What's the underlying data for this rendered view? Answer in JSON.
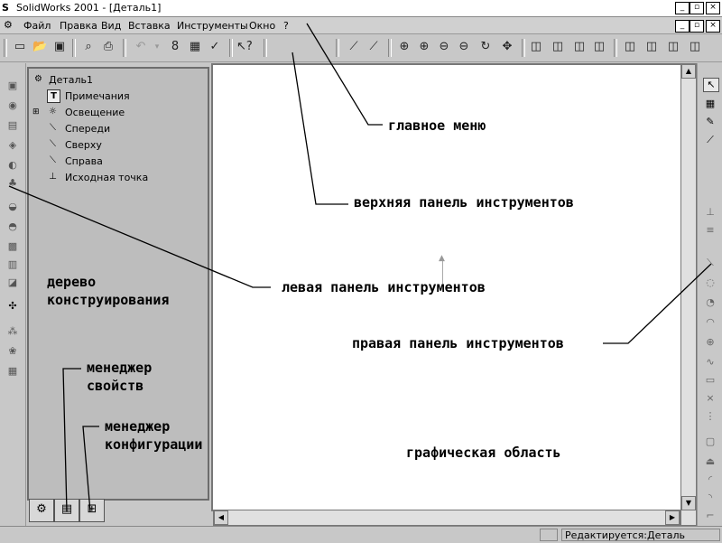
{
  "window": {
    "title": "SolidWorks 2001 - [Деталь1]",
    "app_icon": "solidworks-logo-icon"
  },
  "menu": {
    "items": [
      "Файл",
      "Правка",
      "Вид",
      "Вставка",
      "Инструменты",
      "Окно",
      "?"
    ]
  },
  "tree": {
    "root": "Деталь1",
    "items": [
      {
        "label": "Примечания",
        "icon": "annotations-icon"
      },
      {
        "label": "Освещение",
        "icon": "lighting-icon"
      },
      {
        "label": "Спереди",
        "icon": "plane-icon"
      },
      {
        "label": "Сверху",
        "icon": "plane-icon"
      },
      {
        "label": "Справа",
        "icon": "plane-icon"
      },
      {
        "label": "Исходная точка",
        "icon": "origin-icon"
      }
    ]
  },
  "status": {
    "text": "Редактируется:Деталь"
  },
  "annotations": {
    "main_menu": "главное меню",
    "top_toolbar": "верхняя панель инструментов",
    "left_toolbar": "левая панель инструментов",
    "feature_tree": "дерево\nконструирования",
    "right_toolbar": "правая панель инструментов",
    "property_manager": "менеджер\nсвойств",
    "config_manager": "менеджер\nконфигурации",
    "graphics_area": "графическая область"
  }
}
